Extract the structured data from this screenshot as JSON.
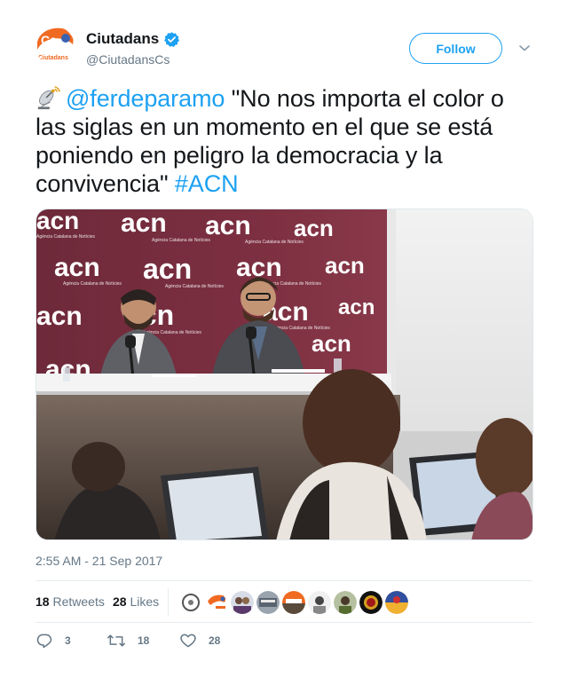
{
  "account": {
    "name": "Ciutadans",
    "handle": "@CiutadansCs",
    "logo_text_top": "Cs",
    "logo_text_bottom": "Ciutadans",
    "brand_color": "#f06a22",
    "verified": true
  },
  "follow_button": {
    "label": "Follow"
  },
  "tweet": {
    "mention": "@ferdeparamo",
    "text_after_mention": " \"No nos importa el color o las siglas en un momento en el que se está poniendo en peligro la democracia y la convivencia\" ",
    "hashtag": "#ACN",
    "link_color": "#1da1f2"
  },
  "media": {
    "backdrop_logo": "acn",
    "backdrop_subtitle": "Agència Catalana de Notícies"
  },
  "timestamp": "2:55 AM - 21 Sep 2017",
  "stats": {
    "retweets_count": "18",
    "retweets_label": "Retweets",
    "likes_count": "28",
    "likes_label": "Likes",
    "retweeter_avatar_count": 9
  },
  "actions": {
    "reply_count": "3",
    "retweet_count": "18",
    "like_count": "28"
  },
  "icons": [
    "verified-badge-icon",
    "chevron-down-icon",
    "satellite-antenna-emoji",
    "reply-icon",
    "retweet-icon",
    "heart-icon"
  ]
}
